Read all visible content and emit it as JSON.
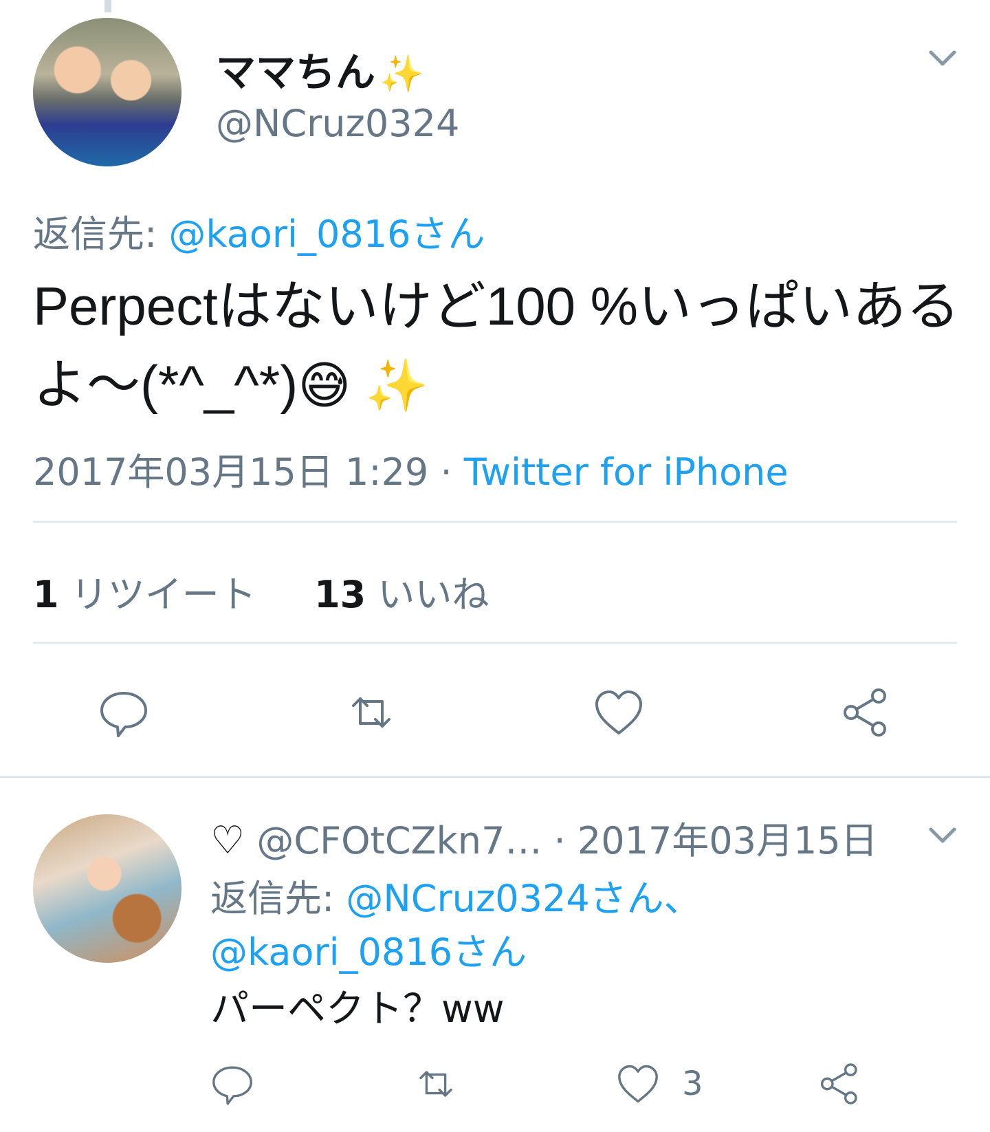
{
  "main_tweet": {
    "display_name": "ママちん",
    "name_emoji": "✨",
    "handle": "@NCruz0324",
    "reply_prefix": "返信先:",
    "reply_mention": "@kaori_0816さん",
    "text": "Perpectはないけど100 %いっぱいあるよ〜(*^_^*)",
    "text_emojis": "😅 ✨",
    "timestamp": "2017年03月15日 1:29",
    "separator": " · ",
    "source": "Twitter for iPhone",
    "retweet_count": "1",
    "retweet_label": "リツイート",
    "like_count": "13",
    "like_label": "いいね",
    "actions": [
      "reply-icon",
      "retweet-icon",
      "heart-icon",
      "share-icon"
    ]
  },
  "reply_tweet": {
    "heart_glyph": "♡",
    "handle": "@CFOtCZkn7…",
    "date": " · 2017年03月15日",
    "reply_prefix": "返信先:",
    "reply_mention_1": "@NCruz0324さん、",
    "reply_mention_2": "@kaori_0816さん",
    "text": "パーペクト？ww",
    "like_count": "3",
    "actions": [
      "reply-icon",
      "retweet-icon",
      "heart-icon",
      "share-icon"
    ]
  },
  "colors": {
    "link": "#1da1f2",
    "secondary_text": "#657786",
    "primary_text": "#14171a",
    "divider": "#e1e8ed"
  }
}
